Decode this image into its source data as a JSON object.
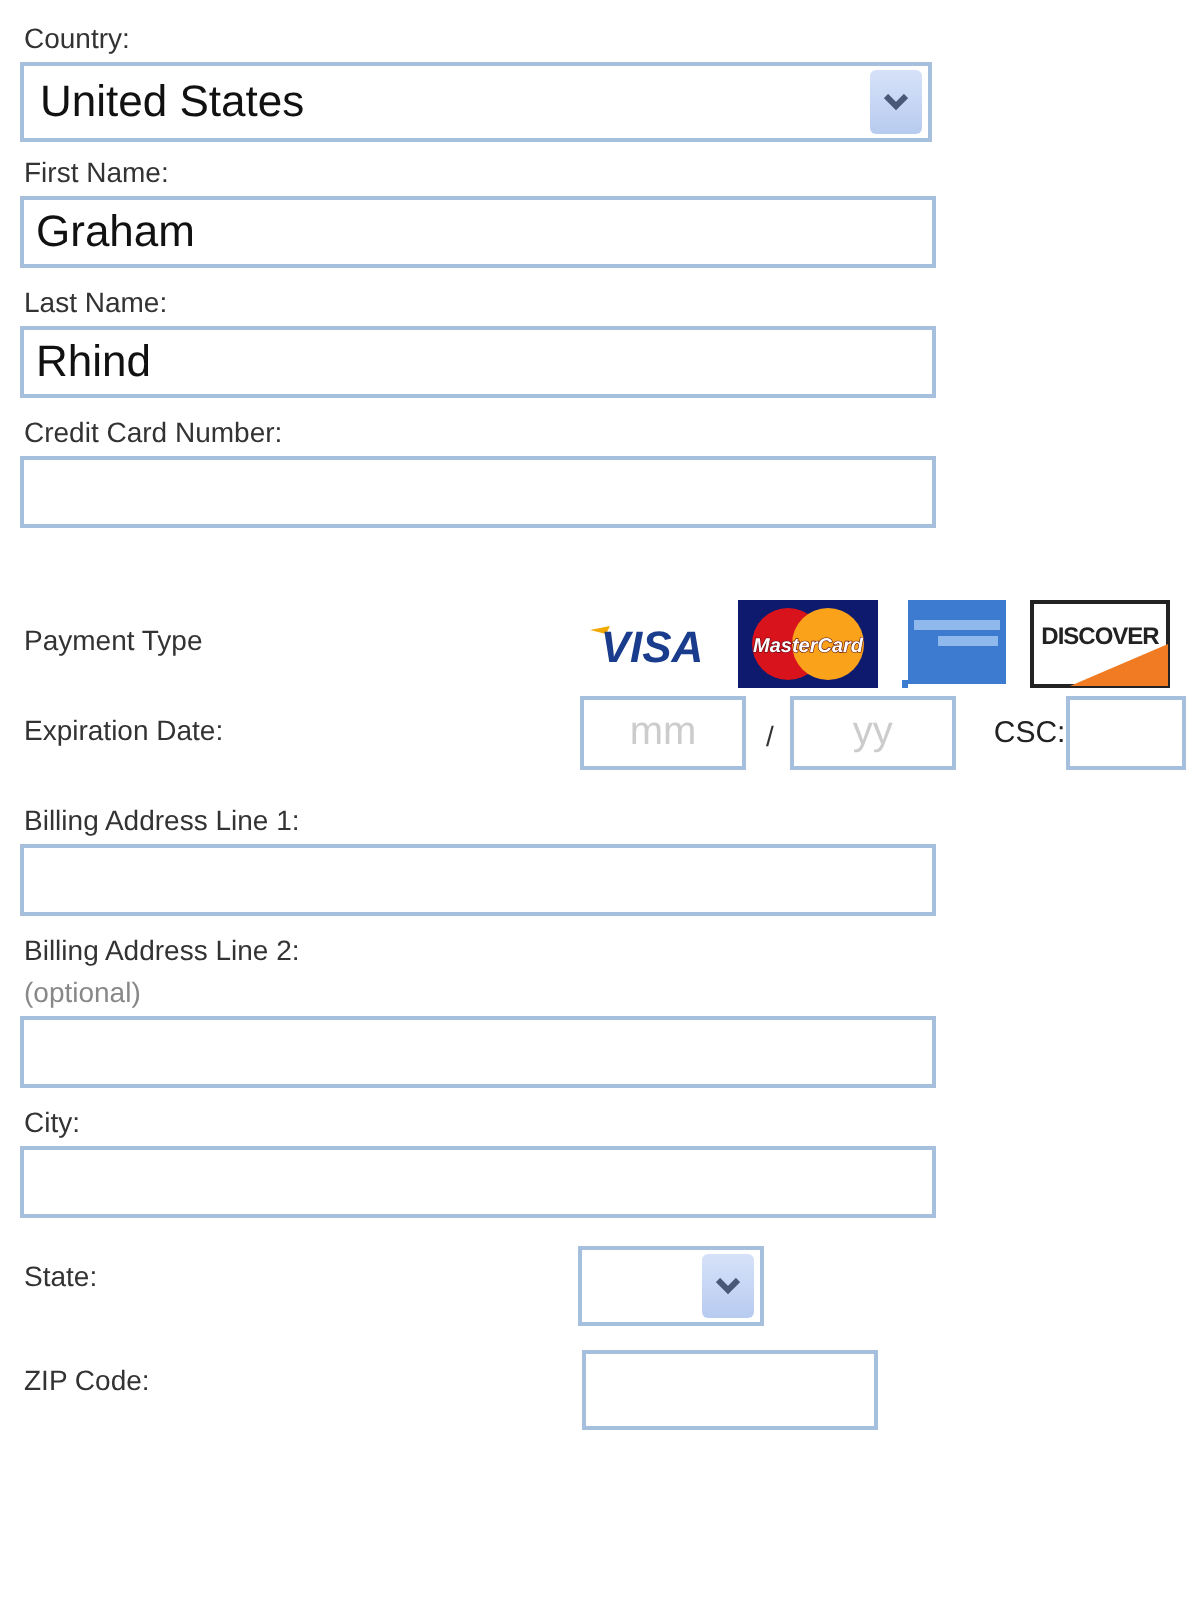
{
  "fields": [
    {
      "kind": "select",
      "label": "Country:",
      "value": "United States"
    },
    {
      "kind": "text",
      "label": "First Name:",
      "value": "Graham"
    },
    {
      "kind": "text",
      "label": "Last Name:",
      "value": "Rhind"
    },
    {
      "kind": "text",
      "label": "Credit Card Number:"
    },
    {
      "kind": "cards",
      "label": "Payment Type",
      "cards": [
        {
          "kind": "visa",
          "text": "VISA"
        },
        {
          "kind": "mastercard",
          "text": "MasterCard"
        },
        {
          "kind": "amex"
        },
        {
          "kind": "discover",
          "text": "DISCOVER"
        }
      ]
    },
    {
      "kind": "expiry",
      "label": "Expiration Date:",
      "month_placeholder": "mm",
      "separator": "/",
      "year_placeholder": "yy",
      "csc_label": "CSC:"
    },
    {
      "kind": "text",
      "label": "Billing Address Line 1:"
    },
    {
      "kind": "text",
      "label": "Billing Address Line 2:",
      "hint": "(optional)"
    },
    {
      "kind": "text",
      "label": "City:"
    },
    {
      "kind": "inline_select",
      "label": "State:"
    },
    {
      "kind": "inline_text",
      "label": "ZIP Code:"
    }
  ]
}
